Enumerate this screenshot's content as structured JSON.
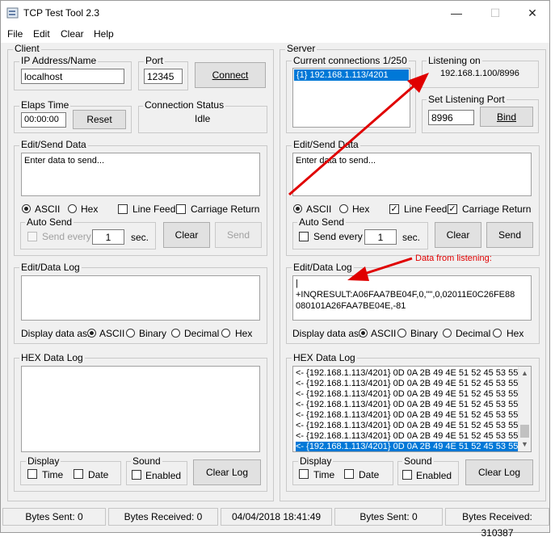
{
  "window": {
    "title": "TCP Test Tool 2.3",
    "minimize": "—",
    "maximize": "☐",
    "close": "✕"
  },
  "menu": [
    "File",
    "Edit",
    "Clear",
    "Help"
  ],
  "client": {
    "legend": "Client",
    "ip_label": "IP Address/Name",
    "ip_value": "localhost",
    "port_label": "Port",
    "port_value": "12345",
    "connect": "Connect",
    "elaps_label": "Elaps Time",
    "elaps_value": "00:00:00",
    "reset": "Reset",
    "conn_status_label": "Connection Status",
    "conn_status_value": "Idle",
    "edit_send_label": "Edit/Send Data",
    "edit_send_placeholder": "Enter data to send...",
    "ascii": "ASCII",
    "hex": "Hex",
    "line_feed": "Line Feed",
    "carriage_return": "Carriage Return",
    "auto_send": "Auto Send",
    "send_every": "Send every",
    "send_every_value": "1",
    "sec": "sec.",
    "clear": "Clear",
    "send": "Send",
    "log_label": "Edit/Data Log",
    "display_as": "Display data as:",
    "fmt_ascii": "ASCII",
    "fmt_binary": "Binary",
    "fmt_decimal": "Decimal",
    "fmt_hex": "Hex",
    "hexlog_label": "HEX Data Log",
    "display": "Display",
    "time": "Time",
    "date": "Date",
    "sound": "Sound",
    "enabled": "Enabled",
    "clear_log": "Clear Log"
  },
  "server": {
    "legend": "Server",
    "conn_label": "Current connections 1/250",
    "connections": [
      "{1} 192.168.1.113/4201"
    ],
    "listening_label": "Listening on",
    "listening_value": "192.168.1.100/8996",
    "set_port_label": "Set Listening Port",
    "set_port_value": "8996",
    "bind": "Bind",
    "edit_send_label": "Edit/Send Data",
    "edit_send_placeholder": "Enter data to send...",
    "ascii": "ASCII",
    "hex": "Hex",
    "line_feed": "Line Feed",
    "carriage_return": "Carriage Return",
    "auto_send": "Auto Send",
    "send_every": "Send every",
    "send_every_value": "1",
    "sec": "sec.",
    "clear": "Clear",
    "send": "Send",
    "log_label": "Edit/Data Log",
    "log_lines": [
      "|",
      "+INQRESULT:A06FAA7BE04F,0,\"\",0,02011E0C26FE88",
      "080101A26FAA7BE04E,-81"
    ],
    "display_as": "Display data as:",
    "fmt_ascii": "ASCII",
    "fmt_binary": "Binary",
    "fmt_decimal": "Decimal",
    "fmt_hex": "Hex",
    "hexlog_label": "HEX Data Log",
    "hex_lines": [
      "<- {192.168.1.113/4201} 0D 0A 2B 49 4E 51 52 45 53 55",
      "<- {192.168.1.113/4201} 0D 0A 2B 49 4E 51 52 45 53 55",
      "<- {192.168.1.113/4201} 0D 0A 2B 49 4E 51 52 45 53 55",
      "<- {192.168.1.113/4201} 0D 0A 2B 49 4E 51 52 45 53 55",
      "<- {192.168.1.113/4201} 0D 0A 2B 49 4E 51 52 45 53 55",
      "<- {192.168.1.113/4201} 0D 0A 2B 49 4E 51 52 45 53 55",
      "<- {192.168.1.113/4201} 0D 0A 2B 49 4E 51 52 45 53 55",
      "<- {192.168.1.113/4201} 0D 0A 2B 49 4E 51 52 45 53 55"
    ],
    "display": "Display",
    "time": "Time",
    "date": "Date",
    "sound": "Sound",
    "enabled": "Enabled",
    "clear_log": "Clear Log"
  },
  "annotation": {
    "text": "Data from listening:",
    "color": "#e00000"
  },
  "statusbar": {
    "sent_left": "Bytes Sent: 0",
    "recv_left": "Bytes Received: 0",
    "datetime": "04/04/2018 18:41:49",
    "sent_right": "Bytes Sent: 0",
    "recv_right": "Bytes Received: 310387"
  },
  "colors": {
    "selection": "#0078d7",
    "arrow": "#e00000"
  }
}
